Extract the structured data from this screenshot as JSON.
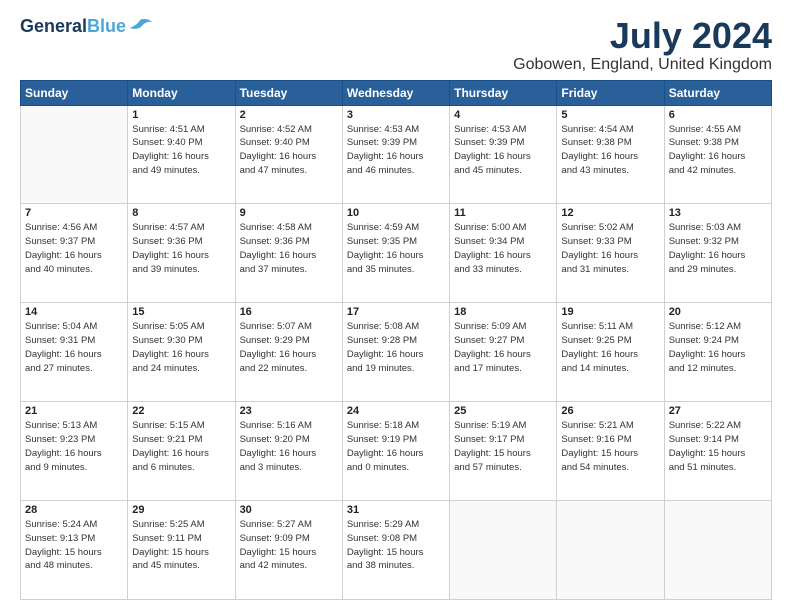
{
  "header": {
    "logo_line1": "General",
    "logo_line2": "Blue",
    "title": "July 2024",
    "subtitle": "Gobowen, England, United Kingdom"
  },
  "days_of_week": [
    "Sunday",
    "Monday",
    "Tuesday",
    "Wednesday",
    "Thursday",
    "Friday",
    "Saturday"
  ],
  "weeks": [
    [
      {
        "day": "",
        "info": ""
      },
      {
        "day": "1",
        "info": "Sunrise: 4:51 AM\nSunset: 9:40 PM\nDaylight: 16 hours\nand 49 minutes."
      },
      {
        "day": "2",
        "info": "Sunrise: 4:52 AM\nSunset: 9:40 PM\nDaylight: 16 hours\nand 47 minutes."
      },
      {
        "day": "3",
        "info": "Sunrise: 4:53 AM\nSunset: 9:39 PM\nDaylight: 16 hours\nand 46 minutes."
      },
      {
        "day": "4",
        "info": "Sunrise: 4:53 AM\nSunset: 9:39 PM\nDaylight: 16 hours\nand 45 minutes."
      },
      {
        "day": "5",
        "info": "Sunrise: 4:54 AM\nSunset: 9:38 PM\nDaylight: 16 hours\nand 43 minutes."
      },
      {
        "day": "6",
        "info": "Sunrise: 4:55 AM\nSunset: 9:38 PM\nDaylight: 16 hours\nand 42 minutes."
      }
    ],
    [
      {
        "day": "7",
        "info": "Sunrise: 4:56 AM\nSunset: 9:37 PM\nDaylight: 16 hours\nand 40 minutes."
      },
      {
        "day": "8",
        "info": "Sunrise: 4:57 AM\nSunset: 9:36 PM\nDaylight: 16 hours\nand 39 minutes."
      },
      {
        "day": "9",
        "info": "Sunrise: 4:58 AM\nSunset: 9:36 PM\nDaylight: 16 hours\nand 37 minutes."
      },
      {
        "day": "10",
        "info": "Sunrise: 4:59 AM\nSunset: 9:35 PM\nDaylight: 16 hours\nand 35 minutes."
      },
      {
        "day": "11",
        "info": "Sunrise: 5:00 AM\nSunset: 9:34 PM\nDaylight: 16 hours\nand 33 minutes."
      },
      {
        "day": "12",
        "info": "Sunrise: 5:02 AM\nSunset: 9:33 PM\nDaylight: 16 hours\nand 31 minutes."
      },
      {
        "day": "13",
        "info": "Sunrise: 5:03 AM\nSunset: 9:32 PM\nDaylight: 16 hours\nand 29 minutes."
      }
    ],
    [
      {
        "day": "14",
        "info": "Sunrise: 5:04 AM\nSunset: 9:31 PM\nDaylight: 16 hours\nand 27 minutes."
      },
      {
        "day": "15",
        "info": "Sunrise: 5:05 AM\nSunset: 9:30 PM\nDaylight: 16 hours\nand 24 minutes."
      },
      {
        "day": "16",
        "info": "Sunrise: 5:07 AM\nSunset: 9:29 PM\nDaylight: 16 hours\nand 22 minutes."
      },
      {
        "day": "17",
        "info": "Sunrise: 5:08 AM\nSunset: 9:28 PM\nDaylight: 16 hours\nand 19 minutes."
      },
      {
        "day": "18",
        "info": "Sunrise: 5:09 AM\nSunset: 9:27 PM\nDaylight: 16 hours\nand 17 minutes."
      },
      {
        "day": "19",
        "info": "Sunrise: 5:11 AM\nSunset: 9:25 PM\nDaylight: 16 hours\nand 14 minutes."
      },
      {
        "day": "20",
        "info": "Sunrise: 5:12 AM\nSunset: 9:24 PM\nDaylight: 16 hours\nand 12 minutes."
      }
    ],
    [
      {
        "day": "21",
        "info": "Sunrise: 5:13 AM\nSunset: 9:23 PM\nDaylight: 16 hours\nand 9 minutes."
      },
      {
        "day": "22",
        "info": "Sunrise: 5:15 AM\nSunset: 9:21 PM\nDaylight: 16 hours\nand 6 minutes."
      },
      {
        "day": "23",
        "info": "Sunrise: 5:16 AM\nSunset: 9:20 PM\nDaylight: 16 hours\nand 3 minutes."
      },
      {
        "day": "24",
        "info": "Sunrise: 5:18 AM\nSunset: 9:19 PM\nDaylight: 16 hours\nand 0 minutes."
      },
      {
        "day": "25",
        "info": "Sunrise: 5:19 AM\nSunset: 9:17 PM\nDaylight: 15 hours\nand 57 minutes."
      },
      {
        "day": "26",
        "info": "Sunrise: 5:21 AM\nSunset: 9:16 PM\nDaylight: 15 hours\nand 54 minutes."
      },
      {
        "day": "27",
        "info": "Sunrise: 5:22 AM\nSunset: 9:14 PM\nDaylight: 15 hours\nand 51 minutes."
      }
    ],
    [
      {
        "day": "28",
        "info": "Sunrise: 5:24 AM\nSunset: 9:13 PM\nDaylight: 15 hours\nand 48 minutes."
      },
      {
        "day": "29",
        "info": "Sunrise: 5:25 AM\nSunset: 9:11 PM\nDaylight: 15 hours\nand 45 minutes."
      },
      {
        "day": "30",
        "info": "Sunrise: 5:27 AM\nSunset: 9:09 PM\nDaylight: 15 hours\nand 42 minutes."
      },
      {
        "day": "31",
        "info": "Sunrise: 5:29 AM\nSunset: 9:08 PM\nDaylight: 15 hours\nand 38 minutes."
      },
      {
        "day": "",
        "info": ""
      },
      {
        "day": "",
        "info": ""
      },
      {
        "day": "",
        "info": ""
      }
    ]
  ]
}
